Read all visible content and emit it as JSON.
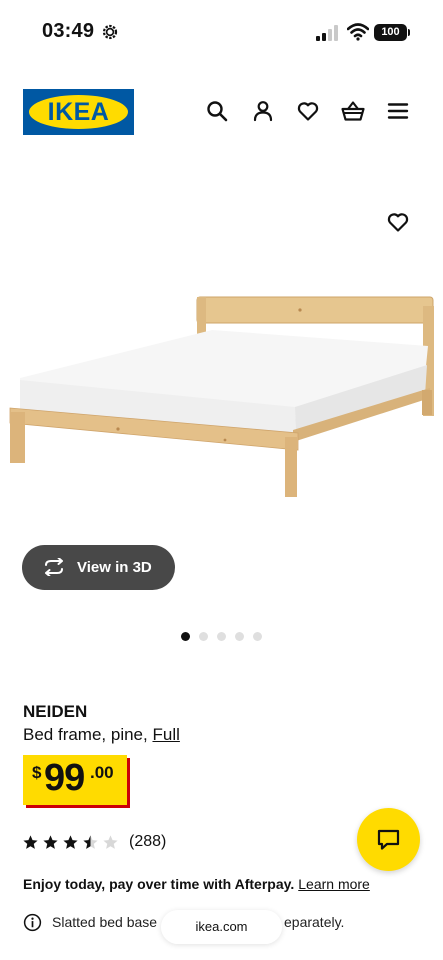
{
  "status_bar": {
    "time": "03:49",
    "battery": "100"
  },
  "header": {
    "logo_text": "IKEA",
    "icons": [
      "search-icon",
      "account-icon",
      "heart-icon",
      "basket-icon",
      "menu-icon"
    ]
  },
  "product": {
    "view_3d_label": "View in 3D",
    "carousel": {
      "count": 5,
      "active": 1
    },
    "name": "NEIDEN",
    "description": "Bed frame, pine,",
    "size": "Full",
    "price": {
      "currency": "$",
      "whole": "99",
      "cents": ".00"
    },
    "rating": {
      "stars": 3.5,
      "max": 5,
      "count": "(288)"
    },
    "afterpay_text": "Enjoy today, pay over time with Afterpay.",
    "afterpay_link": "Learn more",
    "info_text_left": "Slatted bed base",
    "info_text_right": "eparately."
  },
  "browser": {
    "url": "ikea.com"
  },
  "colors": {
    "brand_blue": "#0058a3",
    "brand_yellow": "#ffdb00",
    "price_shadow": "#cc0008",
    "button_dark": "#484848"
  }
}
